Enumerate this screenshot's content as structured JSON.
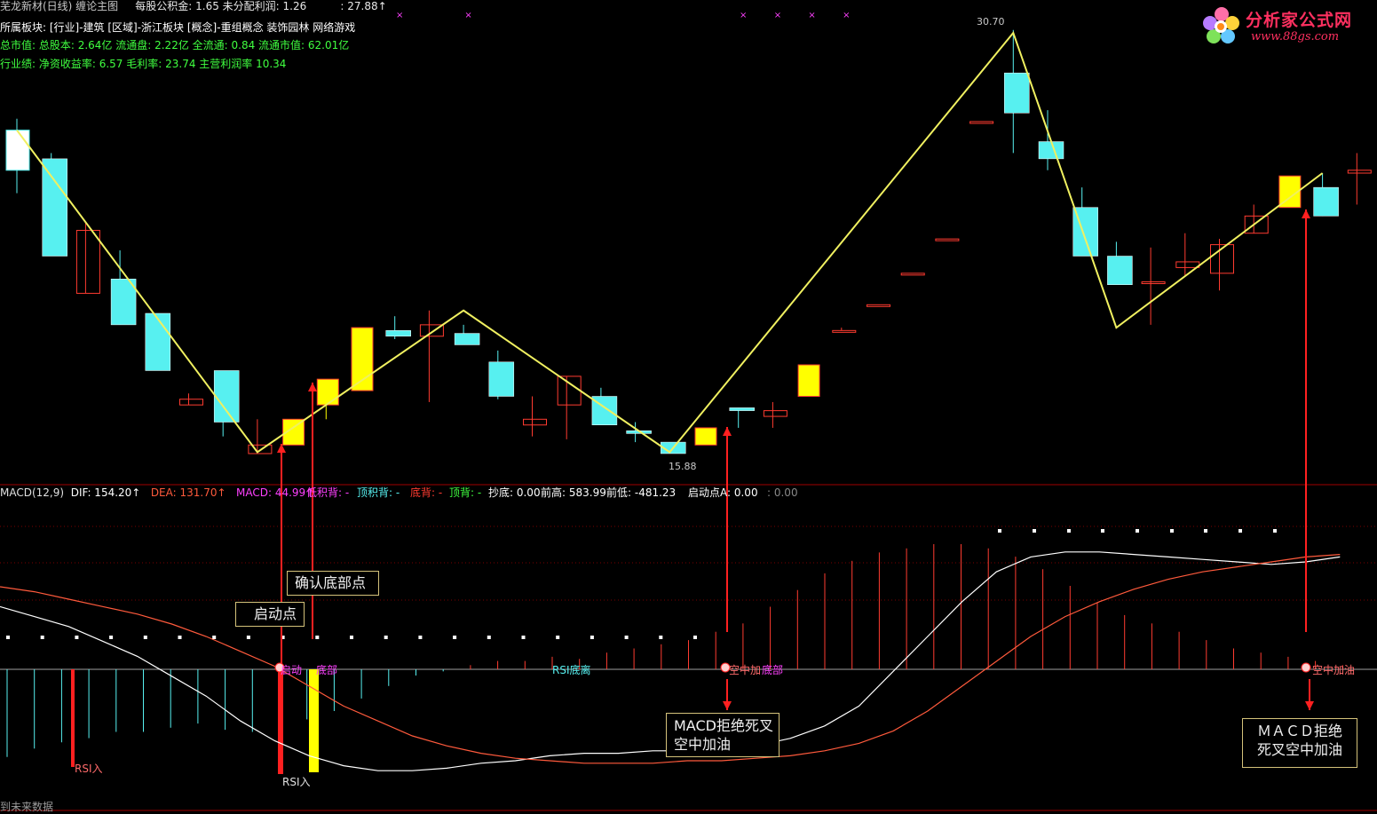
{
  "header": {
    "line1_title": "芜龙新材(日线) 缠论主图",
    "line1_eps": "每股公积金: 1.65 未分配利润: 1.26",
    "line1_price": ": 27.88↑",
    "line2": "所属板块: [行业]-建筑 [区域]-浙江板块 [概念]-重组概念 装饰园林 网络游戏",
    "line3": "总市值: 总股本: 2.64亿 流通盘: 2.22亿 全流通: 0.84 流通市值: 62.01亿",
    "line4": "行业绩: 净资收益率: 6.57 毛利率: 23.74 主营利润率 10.34"
  },
  "logo": {
    "brand": "分析家公式网",
    "url": "www.88gs.com"
  },
  "indicator_header": {
    "macd_label": "MACD(12,9)",
    "dif": "DIF: 154.20↑",
    "dea": "DEA: 131.70↑",
    "macd": "MACD: 44.99↑",
    "low_acc": "低积背: -",
    "top_acc": "顶积背: -",
    "bottom_div": "底背: -",
    "top_div": "顶背: -",
    "chaodi": "抄底: 0.00",
    "prev_high": "前高: 583.99",
    "prev_low": "前低: -481.23",
    "start_point": "启动点A: 0.00",
    "tail": ": 0.00"
  },
  "annotations": {
    "high_label": "30.70",
    "low_label": "15.88",
    "box_start": "启动点",
    "box_confirm": "确认底部点",
    "box_macd1": "MACD拒绝死叉\n空中加油",
    "box_macd2": "ＭＡＣＤ拒绝\n死叉空中加油",
    "sig_qidong": "启动",
    "sig_dibu": "底部",
    "sig_rsi_dl": "RSI底离",
    "sig_kongzhong": "空中加",
    "sig_dibu2": "底部",
    "sig_kongzhong2": "空中加油",
    "rsi_in_1": "RSI入",
    "rsi_in_2": "RSI入",
    "footer": "到未来数据"
  },
  "colors": {
    "up": "#ff3b30",
    "down": "#57f0f0",
    "yellow": "#ffff00",
    "zigzag": "#f0f060",
    "dif": "#ffffff",
    "dea": "#ff5a3c",
    "arrow": "#ff2020",
    "grid": "#7a0000"
  },
  "chart_data": {
    "type": "candlestick",
    "price_range": [
      15.0,
      31.5
    ],
    "candles": [
      {
        "o": 27.2,
        "h": 27.6,
        "l": 25.0,
        "c": 25.8,
        "color": "white"
      },
      {
        "o": 26.2,
        "h": 26.4,
        "l": 22.8,
        "c": 22.8,
        "color": "cyan"
      },
      {
        "o": 21.5,
        "h": 24.0,
        "l": 21.5,
        "c": 23.7,
        "color": "red"
      },
      {
        "o": 22.0,
        "h": 23.0,
        "l": 20.4,
        "c": 20.4,
        "color": "cyan"
      },
      {
        "o": 20.8,
        "h": 20.8,
        "l": 18.8,
        "c": 18.8,
        "color": "cyan"
      },
      {
        "o": 17.6,
        "h": 18.0,
        "l": 17.6,
        "c": 17.8,
        "color": "red"
      },
      {
        "o": 18.8,
        "h": 18.8,
        "l": 16.5,
        "c": 17.0,
        "color": "cyan"
      },
      {
        "o": 15.9,
        "h": 17.1,
        "l": 15.9,
        "c": 16.2,
        "color": "red"
      },
      {
        "o": 16.2,
        "h": 17.1,
        "l": 16.2,
        "c": 17.1,
        "color": "yellow"
      },
      {
        "o": 17.6,
        "h": 17.6,
        "l": 17.1,
        "c": 18.5,
        "color": "yellow"
      },
      {
        "o": 18.1,
        "h": 18.1,
        "l": 18.1,
        "c": 20.3,
        "color": "yellow"
      },
      {
        "o": 20.2,
        "h": 20.7,
        "l": 19.9,
        "c": 20.0,
        "color": "cyan"
      },
      {
        "o": 20.4,
        "h": 20.9,
        "l": 17.7,
        "c": 20.0,
        "color": "red"
      },
      {
        "o": 20.1,
        "h": 20.4,
        "l": 19.8,
        "c": 19.7,
        "color": "cyan"
      },
      {
        "o": 19.1,
        "h": 19.5,
        "l": 17.8,
        "c": 17.9,
        "color": "cyan"
      },
      {
        "o": 17.1,
        "h": 17.9,
        "l": 16.5,
        "c": 16.9,
        "color": "red"
      },
      {
        "o": 17.6,
        "h": 18.6,
        "l": 16.4,
        "c": 18.6,
        "color": "red"
      },
      {
        "o": 17.9,
        "h": 18.2,
        "l": 16.9,
        "c": 16.9,
        "color": "cyan"
      },
      {
        "o": 16.7,
        "h": 17.0,
        "l": 16.3,
        "c": 16.6,
        "color": "cyan"
      },
      {
        "o": 16.3,
        "h": 16.3,
        "l": 15.9,
        "c": 15.9,
        "color": "cyan"
      },
      {
        "o": 16.2,
        "h": 16.2,
        "l": 16.2,
        "c": 16.8,
        "color": "yellow"
      },
      {
        "o": 17.5,
        "h": 17.5,
        "l": 16.8,
        "c": 17.4,
        "color": "cyan"
      },
      {
        "o": 17.2,
        "h": 17.7,
        "l": 16.8,
        "c": 17.4,
        "color": "red"
      },
      {
        "o": 17.9,
        "h": 17.9,
        "l": 17.9,
        "c": 19.0,
        "color": "yellow"
      },
      {
        "o": 20.2,
        "h": 20.3,
        "l": 20.2,
        "c": 20.2,
        "color": "red"
      },
      {
        "o": 21.1,
        "h": 21.1,
        "l": 21.1,
        "c": 21.1,
        "color": "red"
      },
      {
        "o": 22.2,
        "h": 22.2,
        "l": 22.2,
        "c": 22.2,
        "color": "red"
      },
      {
        "o": 23.4,
        "h": 23.4,
        "l": 23.4,
        "c": 23.4,
        "color": "red"
      },
      {
        "o": 27.5,
        "h": 27.5,
        "l": 27.5,
        "c": 27.5,
        "color": "red"
      },
      {
        "o": 29.2,
        "h": 30.7,
        "l": 26.4,
        "c": 27.8,
        "color": "cyan"
      },
      {
        "o": 26.8,
        "h": 27.9,
        "l": 25.8,
        "c": 26.2,
        "color": "cyan"
      },
      {
        "o": 24.5,
        "h": 25.2,
        "l": 22.8,
        "c": 22.8,
        "color": "cyan"
      },
      {
        "o": 22.8,
        "h": 23.3,
        "l": 21.8,
        "c": 21.8,
        "color": "cyan"
      },
      {
        "o": 21.9,
        "h": 23.1,
        "l": 20.4,
        "c": 21.9,
        "color": "red"
      },
      {
        "o": 22.4,
        "h": 23.6,
        "l": 22.1,
        "c": 22.6,
        "color": "red"
      },
      {
        "o": 22.2,
        "h": 23.4,
        "l": 21.6,
        "c": 23.2,
        "color": "red"
      },
      {
        "o": 23.6,
        "h": 24.6,
        "l": 23.6,
        "c": 24.2,
        "color": "red"
      },
      {
        "o": 24.5,
        "h": 25.6,
        "l": 24.5,
        "c": 25.6,
        "color": "yellow"
      },
      {
        "o": 25.2,
        "h": 25.7,
        "l": 24.2,
        "c": 24.2,
        "color": "cyan"
      },
      {
        "o": 25.8,
        "h": 26.4,
        "l": 24.6,
        "c": 25.7,
        "color": "red"
      }
    ],
    "macd_histogram": [
      -42,
      -38,
      -35,
      -33,
      -30,
      -30,
      -28,
      -26,
      -29,
      -30,
      -28,
      -24,
      -20,
      -14,
      -8,
      -3,
      -1,
      2,
      4,
      4,
      6,
      5,
      8,
      10,
      12,
      14,
      18,
      22,
      30,
      38,
      46,
      52,
      56,
      58,
      60,
      60,
      58,
      54,
      48,
      40,
      32,
      26,
      22,
      18,
      14,
      10,
      8,
      6,
      4,
      2
    ],
    "dif": [
      22,
      18,
      14,
      8,
      2,
      -6,
      -14,
      -24,
      -32,
      -38,
      -42,
      -44,
      -44,
      -43,
      -41,
      -40,
      -38,
      -37,
      -37,
      -36,
      -36,
      -35,
      -34,
      -31,
      -26,
      -18,
      -4,
      10,
      24,
      36,
      42,
      44,
      44,
      43,
      42,
      41,
      40,
      39,
      40,
      42
    ],
    "dea": [
      30,
      28,
      25,
      22,
      19,
      15,
      10,
      4,
      -2,
      -10,
      -18,
      -24,
      -30,
      -34,
      -37,
      -39,
      -40,
      -41,
      -41,
      -41,
      -40,
      -40,
      -39,
      -38,
      -36,
      -33,
      -28,
      -20,
      -10,
      0,
      10,
      18,
      24,
      29,
      33,
      36,
      38,
      40,
      42,
      43
    ]
  }
}
